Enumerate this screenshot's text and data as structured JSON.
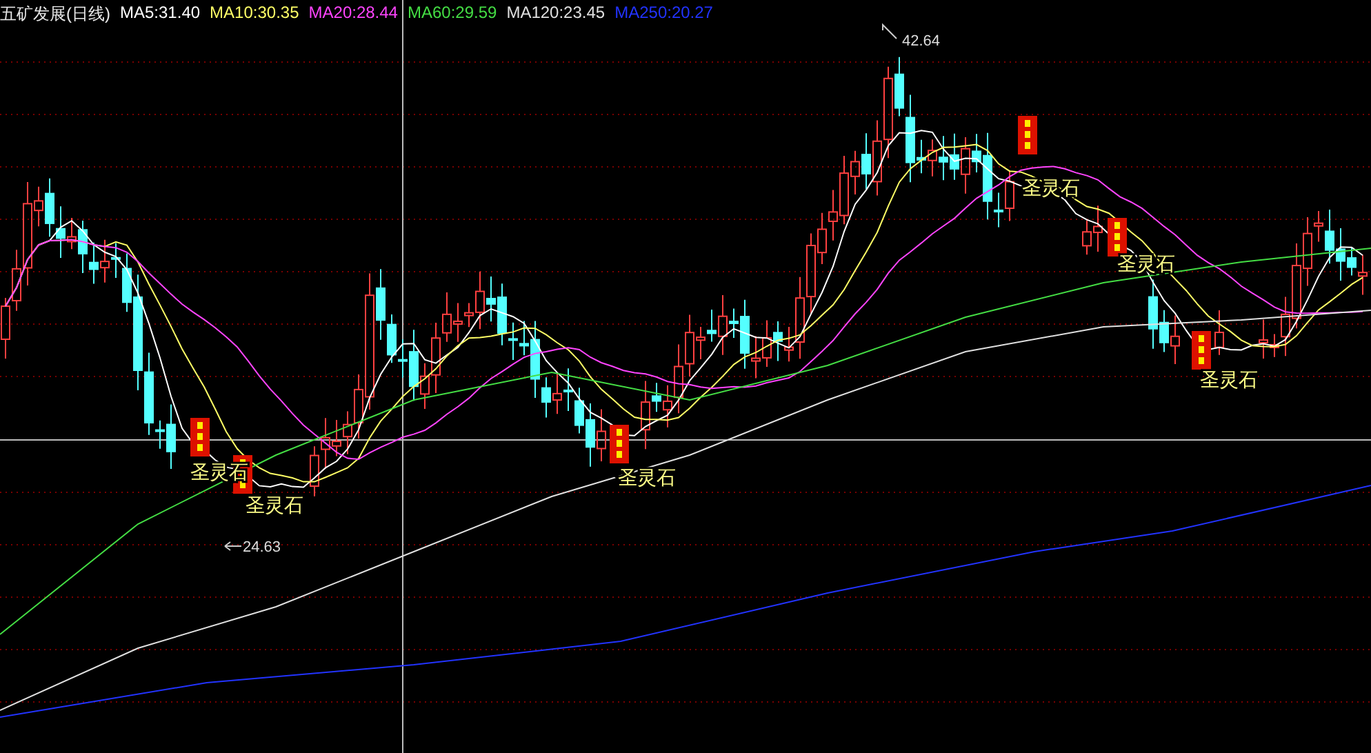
{
  "chart_title": "五矿发展(日线)",
  "ma_legend": [
    {
      "text": "MA5:31.40",
      "color": "#ffffff"
    },
    {
      "text": "MA10:30.35",
      "color": "#ffff66"
    },
    {
      "text": "MA20:28.44",
      "color": "#ff44ff"
    },
    {
      "text": "MA60:29.59",
      "color": "#44dd44"
    },
    {
      "text": "MA120:23.45",
      "color": "#e0e0e0"
    },
    {
      "text": "MA250:20.27",
      "color": "#2233ff"
    }
  ],
  "high_label": "42.64",
  "low_label": "24.63",
  "signals": [
    {
      "label": "圣灵石"
    },
    {
      "label": "圣灵石"
    },
    {
      "label": "圣灵石"
    },
    {
      "label": "圣灵石"
    },
    {
      "label": "圣灵石"
    },
    {
      "label": "圣灵石"
    }
  ]
}
